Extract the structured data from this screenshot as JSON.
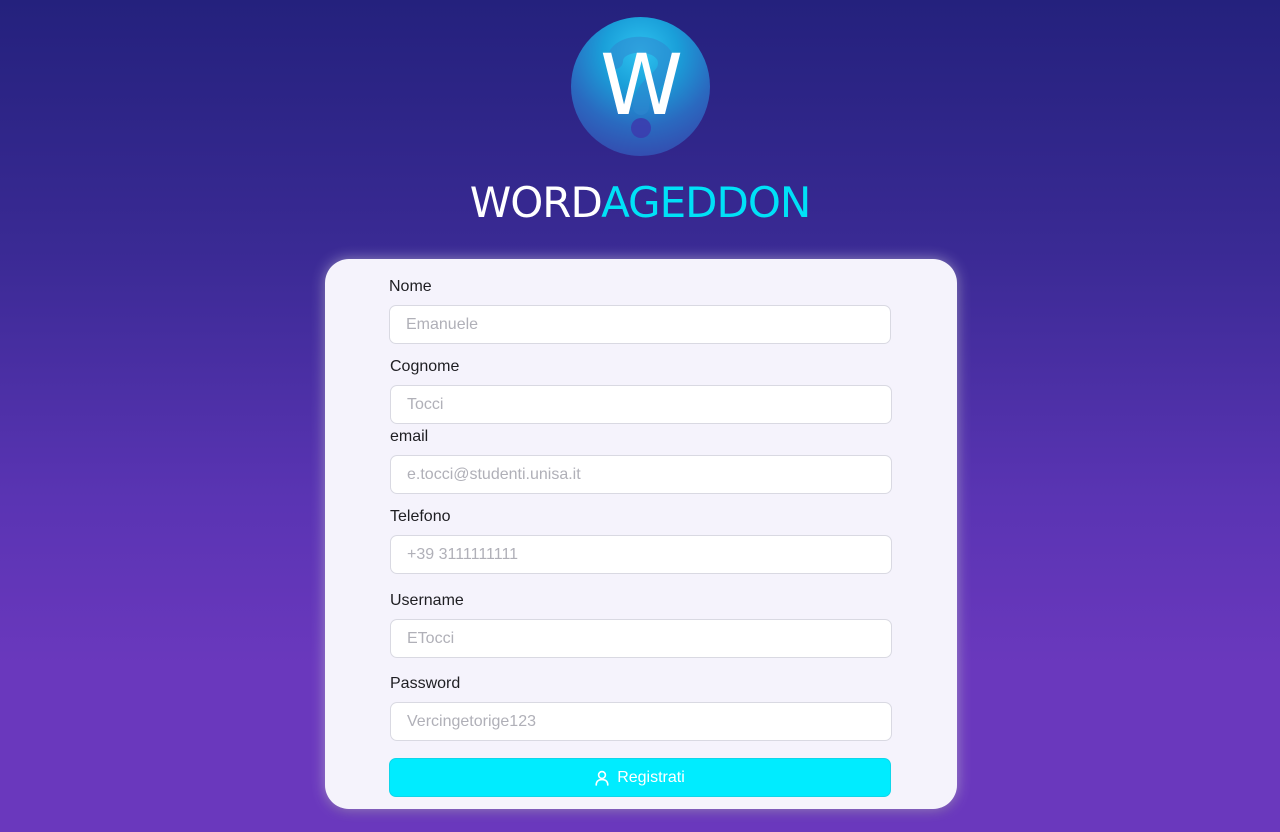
{
  "brand": {
    "logo_letter": "W",
    "name_part1": "WORD",
    "name_part2": "AGEDDON",
    "accent_color": "#00e1f7"
  },
  "form": {
    "fields": [
      {
        "label": "Nome",
        "placeholder": "Emanuele",
        "value": ""
      },
      {
        "label": "Cognome",
        "placeholder": "Tocci",
        "value": ""
      },
      {
        "label": "email",
        "placeholder": "e.tocci@studenti.unisa.it",
        "value": ""
      },
      {
        "label": "Telefono",
        "placeholder": "+39 3111111111",
        "value": ""
      },
      {
        "label": "Username",
        "placeholder": "ETocci",
        "value": ""
      },
      {
        "label": "Password",
        "placeholder": "Vercingetorige123",
        "value": ""
      }
    ],
    "submit": {
      "label": "Registrati",
      "icon": "user-icon",
      "color": "#00ecff"
    }
  }
}
